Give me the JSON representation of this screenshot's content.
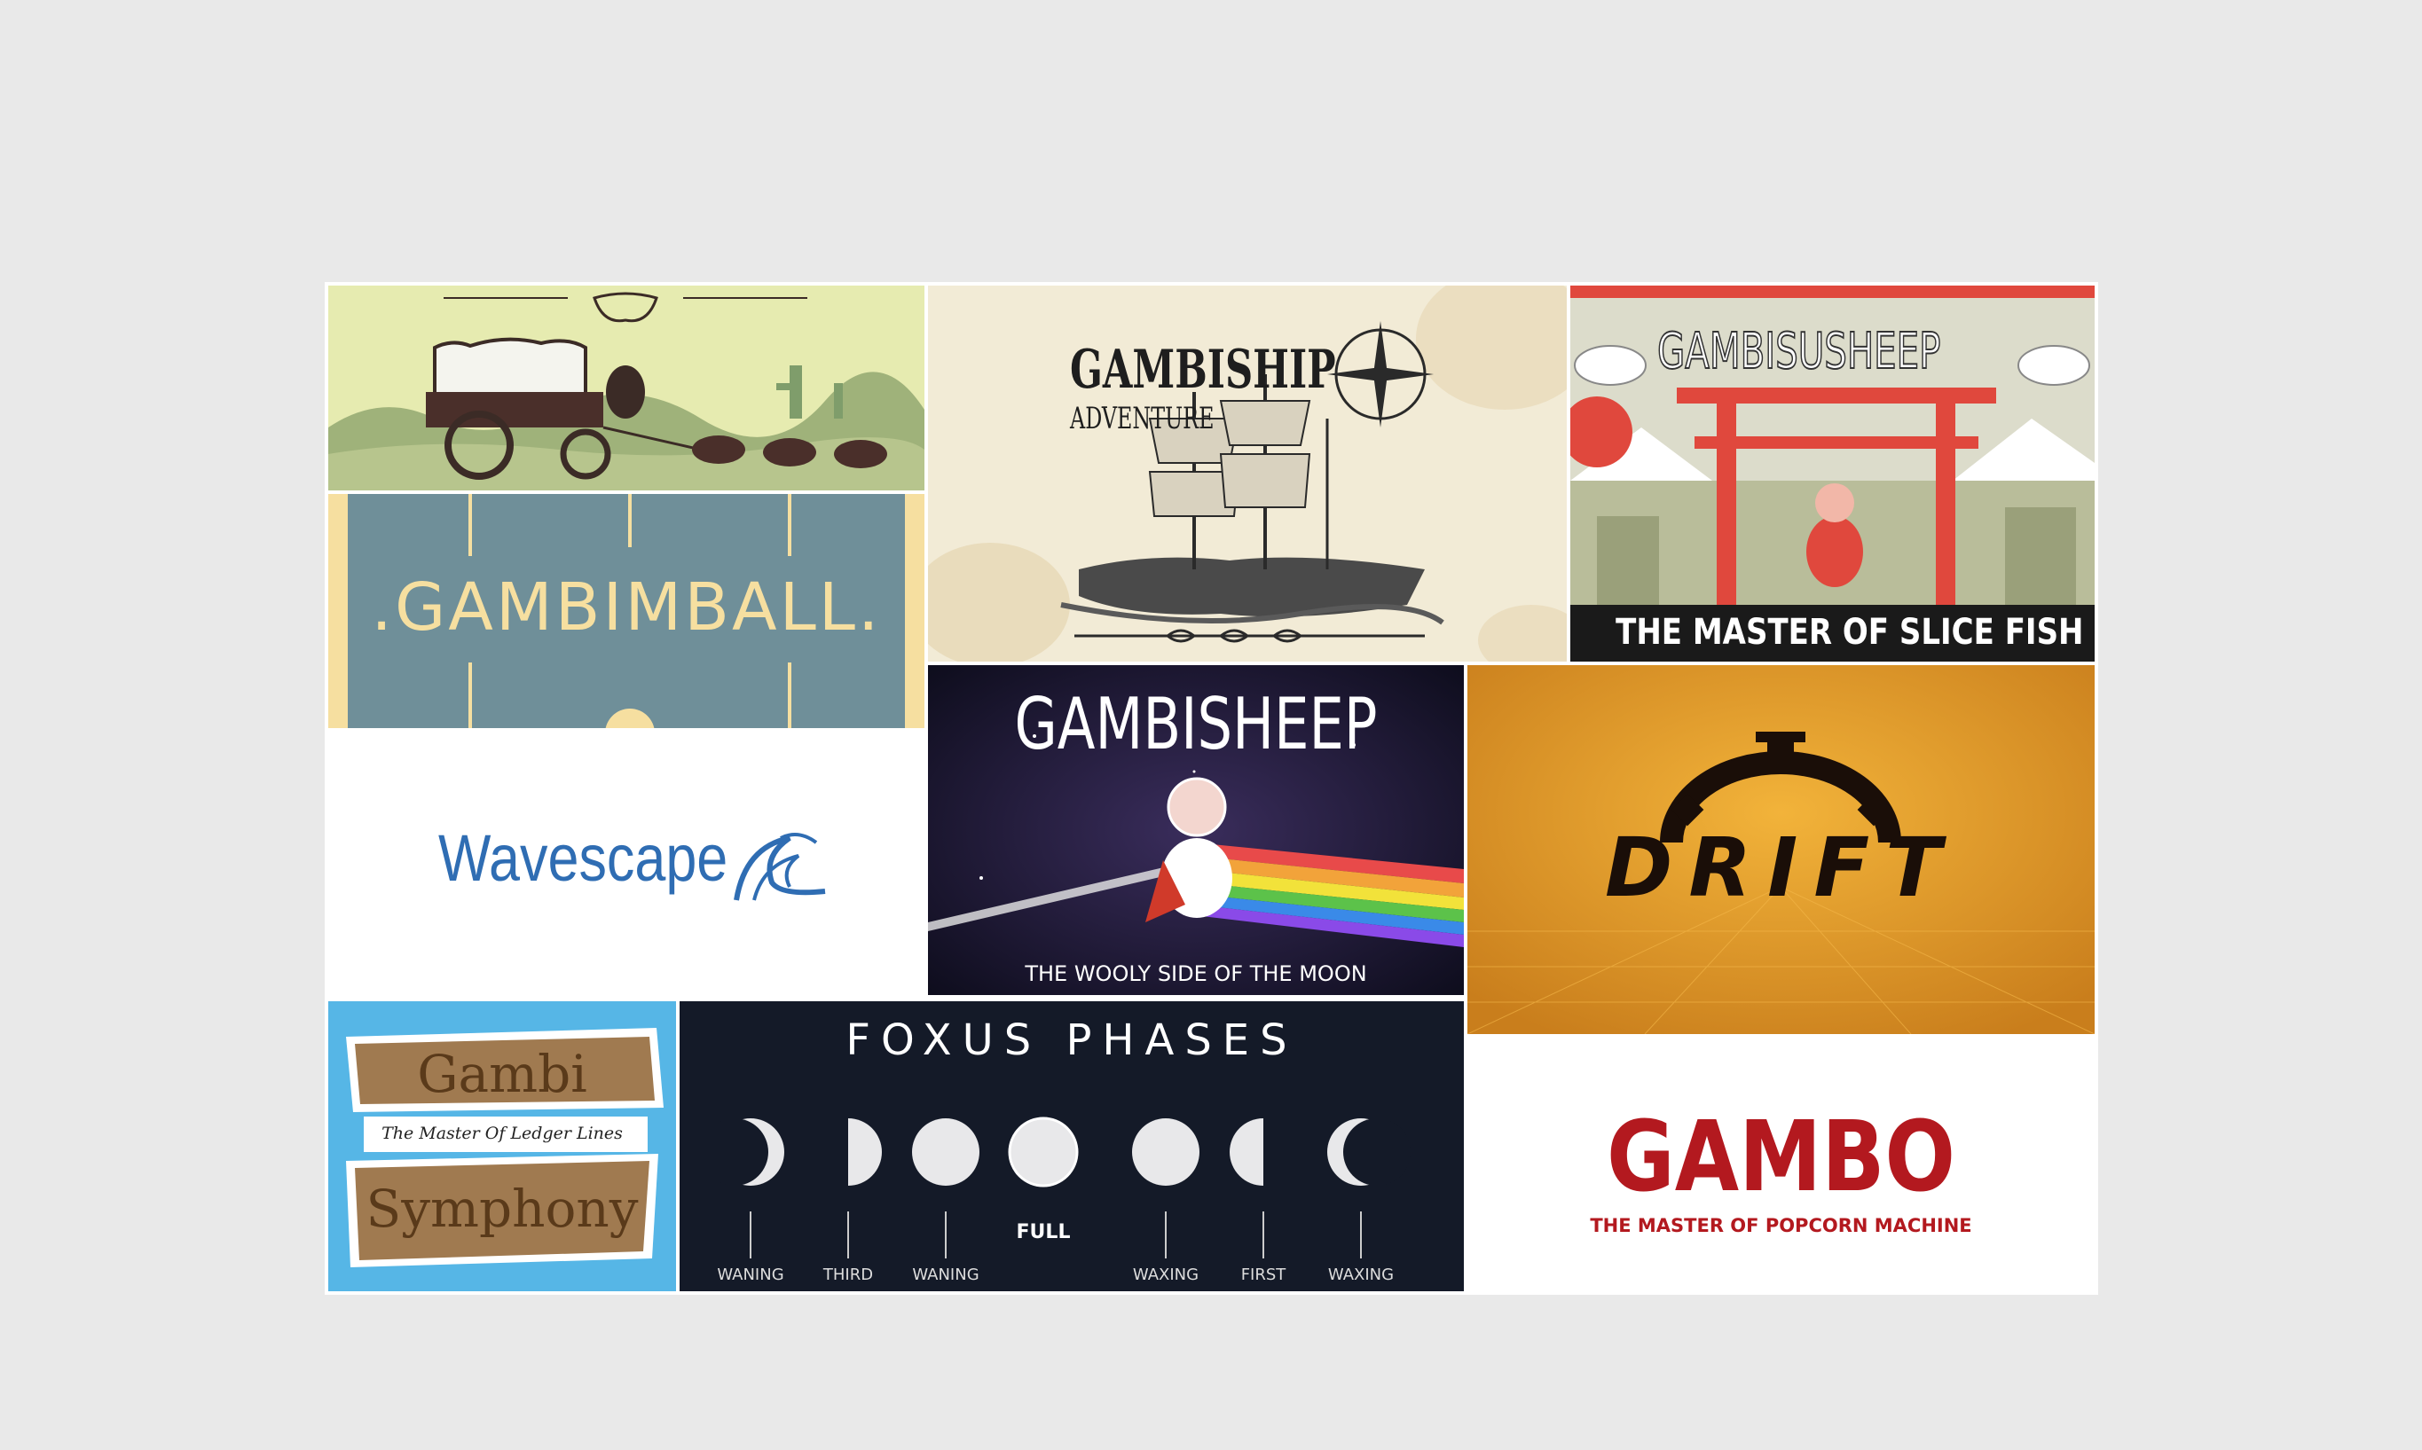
{
  "gallery": {
    "tiles": [
      {
        "id": "wagon",
        "title": ""
      },
      {
        "id": "gambimball",
        "title": ".GAMBIMBALL."
      },
      {
        "id": "wavescape",
        "title": "Wavescape"
      },
      {
        "id": "gambiship",
        "title": "GAMBISHIP",
        "subtitle": "ADVENTURE"
      },
      {
        "id": "gambisusheep",
        "title": "GAMBISUSHEEP",
        "subtitle": "THE MASTER OF SLICE FISH"
      },
      {
        "id": "gambisheep",
        "title": "GAMBISHEEP",
        "subtitle": "THE WOOLY SIDE OF THE MOON"
      },
      {
        "id": "drift",
        "title": "DRIFT"
      },
      {
        "id": "gambi-symphony",
        "title_line1": "Gambi",
        "tagline": "The Master Of Ledger Lines",
        "title_line2": "Symphony"
      },
      {
        "id": "foxus-phases",
        "title": "FOXUS PHASES",
        "phases": [
          "WANING",
          "THIRD",
          "WANING",
          "FULL",
          "WAXING",
          "FIRST",
          "WAXING"
        ]
      },
      {
        "id": "gambo",
        "title": "GAMBO",
        "subtitle": "THE MASTER OF POPCORN MACHINE"
      }
    ]
  },
  "colors": {
    "page_bg": "#e9e9e9",
    "wave_blue": "#2f6db3",
    "gambo_red": "#b3191f",
    "sushi_red": "#e0483d",
    "drift_orange": "#e09a2a",
    "ball_teal": "#6f8f99"
  }
}
